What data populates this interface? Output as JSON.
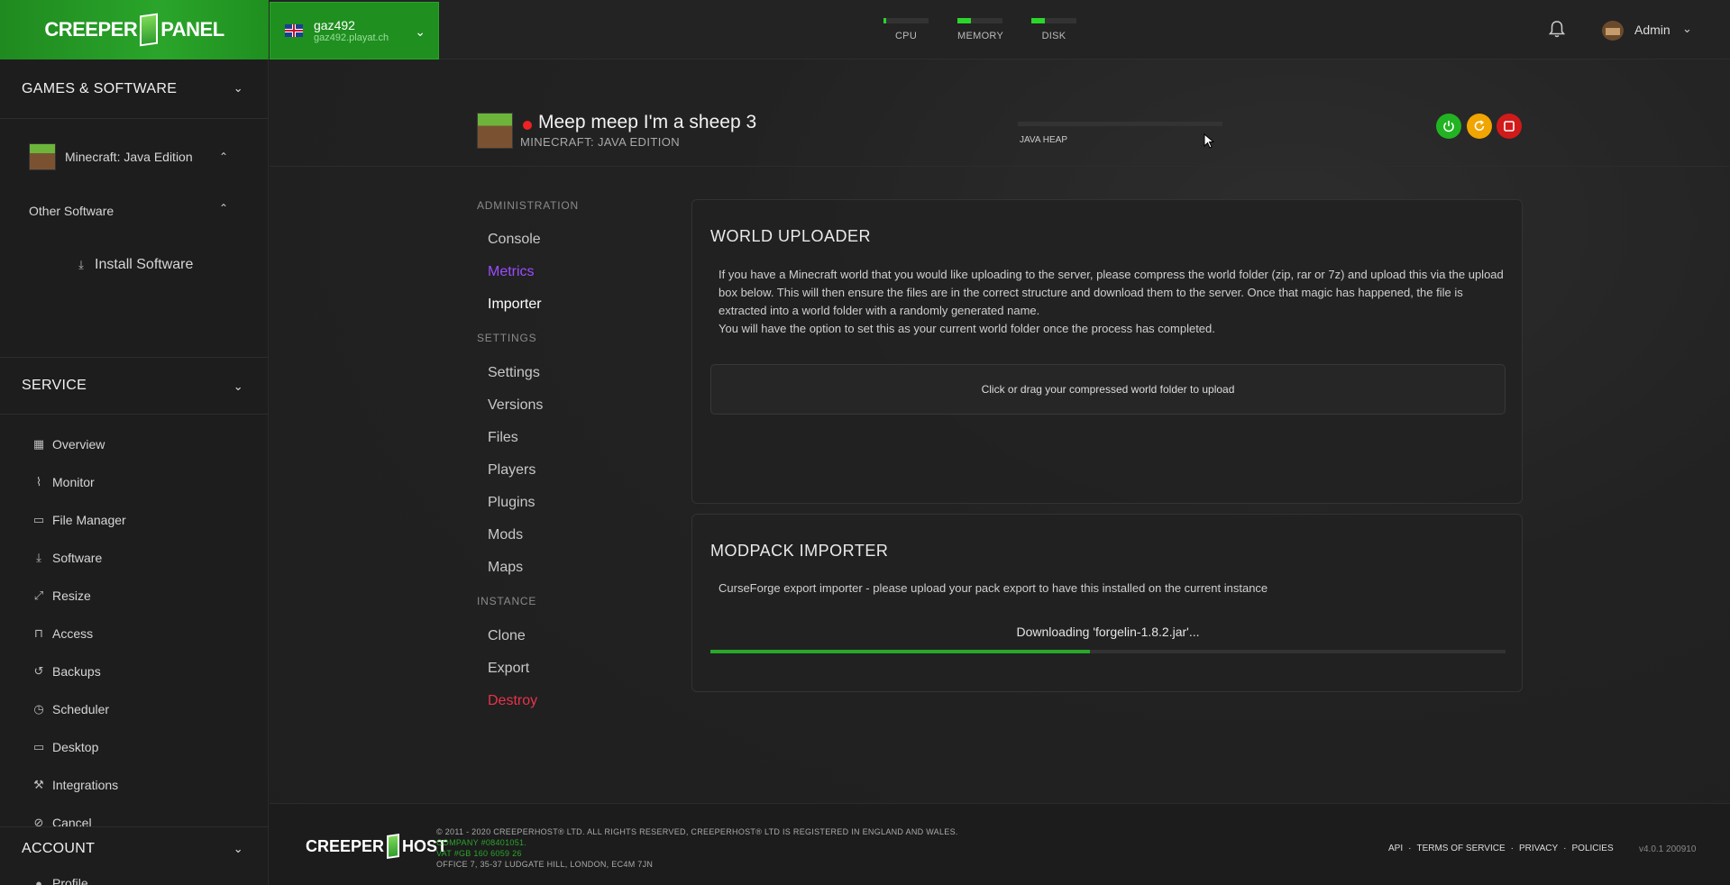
{
  "brand": {
    "logo_left": "CREEPER",
    "logo_right": "PANEL"
  },
  "server": {
    "name": "gaz492",
    "host": "gaz492.playat.ch"
  },
  "meters": [
    {
      "label": "CPU",
      "value": 5
    },
    {
      "label": "MEMORY",
      "value": 30
    },
    {
      "label": "DISK",
      "value": 30
    }
  ],
  "user": {
    "name": "Admin"
  },
  "sidebar": {
    "games_header": "GAMES & SOFTWARE",
    "game_item": "Minecraft: Java Edition",
    "other_software": "Other Software",
    "install_software": "Install Software",
    "service_header": "SERVICE",
    "service_items": [
      "Overview",
      "Monitor",
      "File Manager",
      "Software",
      "Resize",
      "Access",
      "Backups",
      "Scheduler",
      "Desktop",
      "Integrations",
      "Cancel"
    ],
    "account_header": "ACCOUNT",
    "account_first": "Profile"
  },
  "header": {
    "title": "Meep meep I'm a sheep 3",
    "subtitle": "MINECRAFT: JAVA EDITION",
    "heap_label": "JAVA HEAP",
    "status": "offline"
  },
  "subnav": {
    "administration": "ADMINISTRATION",
    "admin_items": [
      "Console",
      "Metrics",
      "Importer"
    ],
    "settings": "SETTINGS",
    "settings_items": [
      "Settings",
      "Versions",
      "Files",
      "Players",
      "Plugins",
      "Mods",
      "Maps"
    ],
    "instance": "INSTANCE",
    "instance_items": [
      "Clone",
      "Export",
      "Destroy"
    ]
  },
  "world_uploader": {
    "title": "WORLD UPLOADER",
    "text1": "If you have a Minecraft world that you would like uploading to the server, please compress the world folder (zip, rar or 7z) and upload this via the upload box below. This will then ensure the files are in the correct structure and download them to the server. Once that magic has happened, the file is extracted into a world folder with a randomly generated name.",
    "text2": "You will have the option to set this as your current world folder once the process has completed.",
    "dropzone": "Click or drag your compressed world folder to upload"
  },
  "modpack_importer": {
    "title": "MODPACK IMPORTER",
    "text": "CurseForge export importer - please upload your pack export to have this installed on the current instance",
    "download_status": "Downloading 'forgelin-1.8.2.jar'...",
    "progress": 0.477
  },
  "footer": {
    "logo_left": "CREEPER",
    "logo_right": "HOST",
    "copyright": "© 2011 - 2020 CREEPERHOST® LTD. ALL RIGHTS RESERVED, CREEPERHOST® LTD IS REGISTERED IN ENGLAND AND WALES.",
    "company": "COMPANY #08401051.",
    "vat": "VAT #GB 160 6059 26",
    "office": "OFFICE 7, 35-37 LUDGATE HILL, LONDON, EC4M 7JN",
    "links": [
      "API",
      "TERMS OF SERVICE",
      "PRIVACY",
      "POLICIES"
    ],
    "version": "v4.0.1 200910"
  },
  "colors": {
    "accent": "#2aa52a",
    "active_nav": "#9b4dff",
    "danger": "#e8334a",
    "power_on": "#22b322",
    "restart": "#f0a500",
    "stop": "#d11a1a"
  },
  "icons": {
    "services": [
      "grid-icon",
      "pulse-icon",
      "folder-icon",
      "download-icon",
      "expand-icon",
      "lock-icon",
      "history-icon",
      "clock-icon",
      "monitor-icon",
      "wrench-icon",
      "ban-icon"
    ]
  }
}
